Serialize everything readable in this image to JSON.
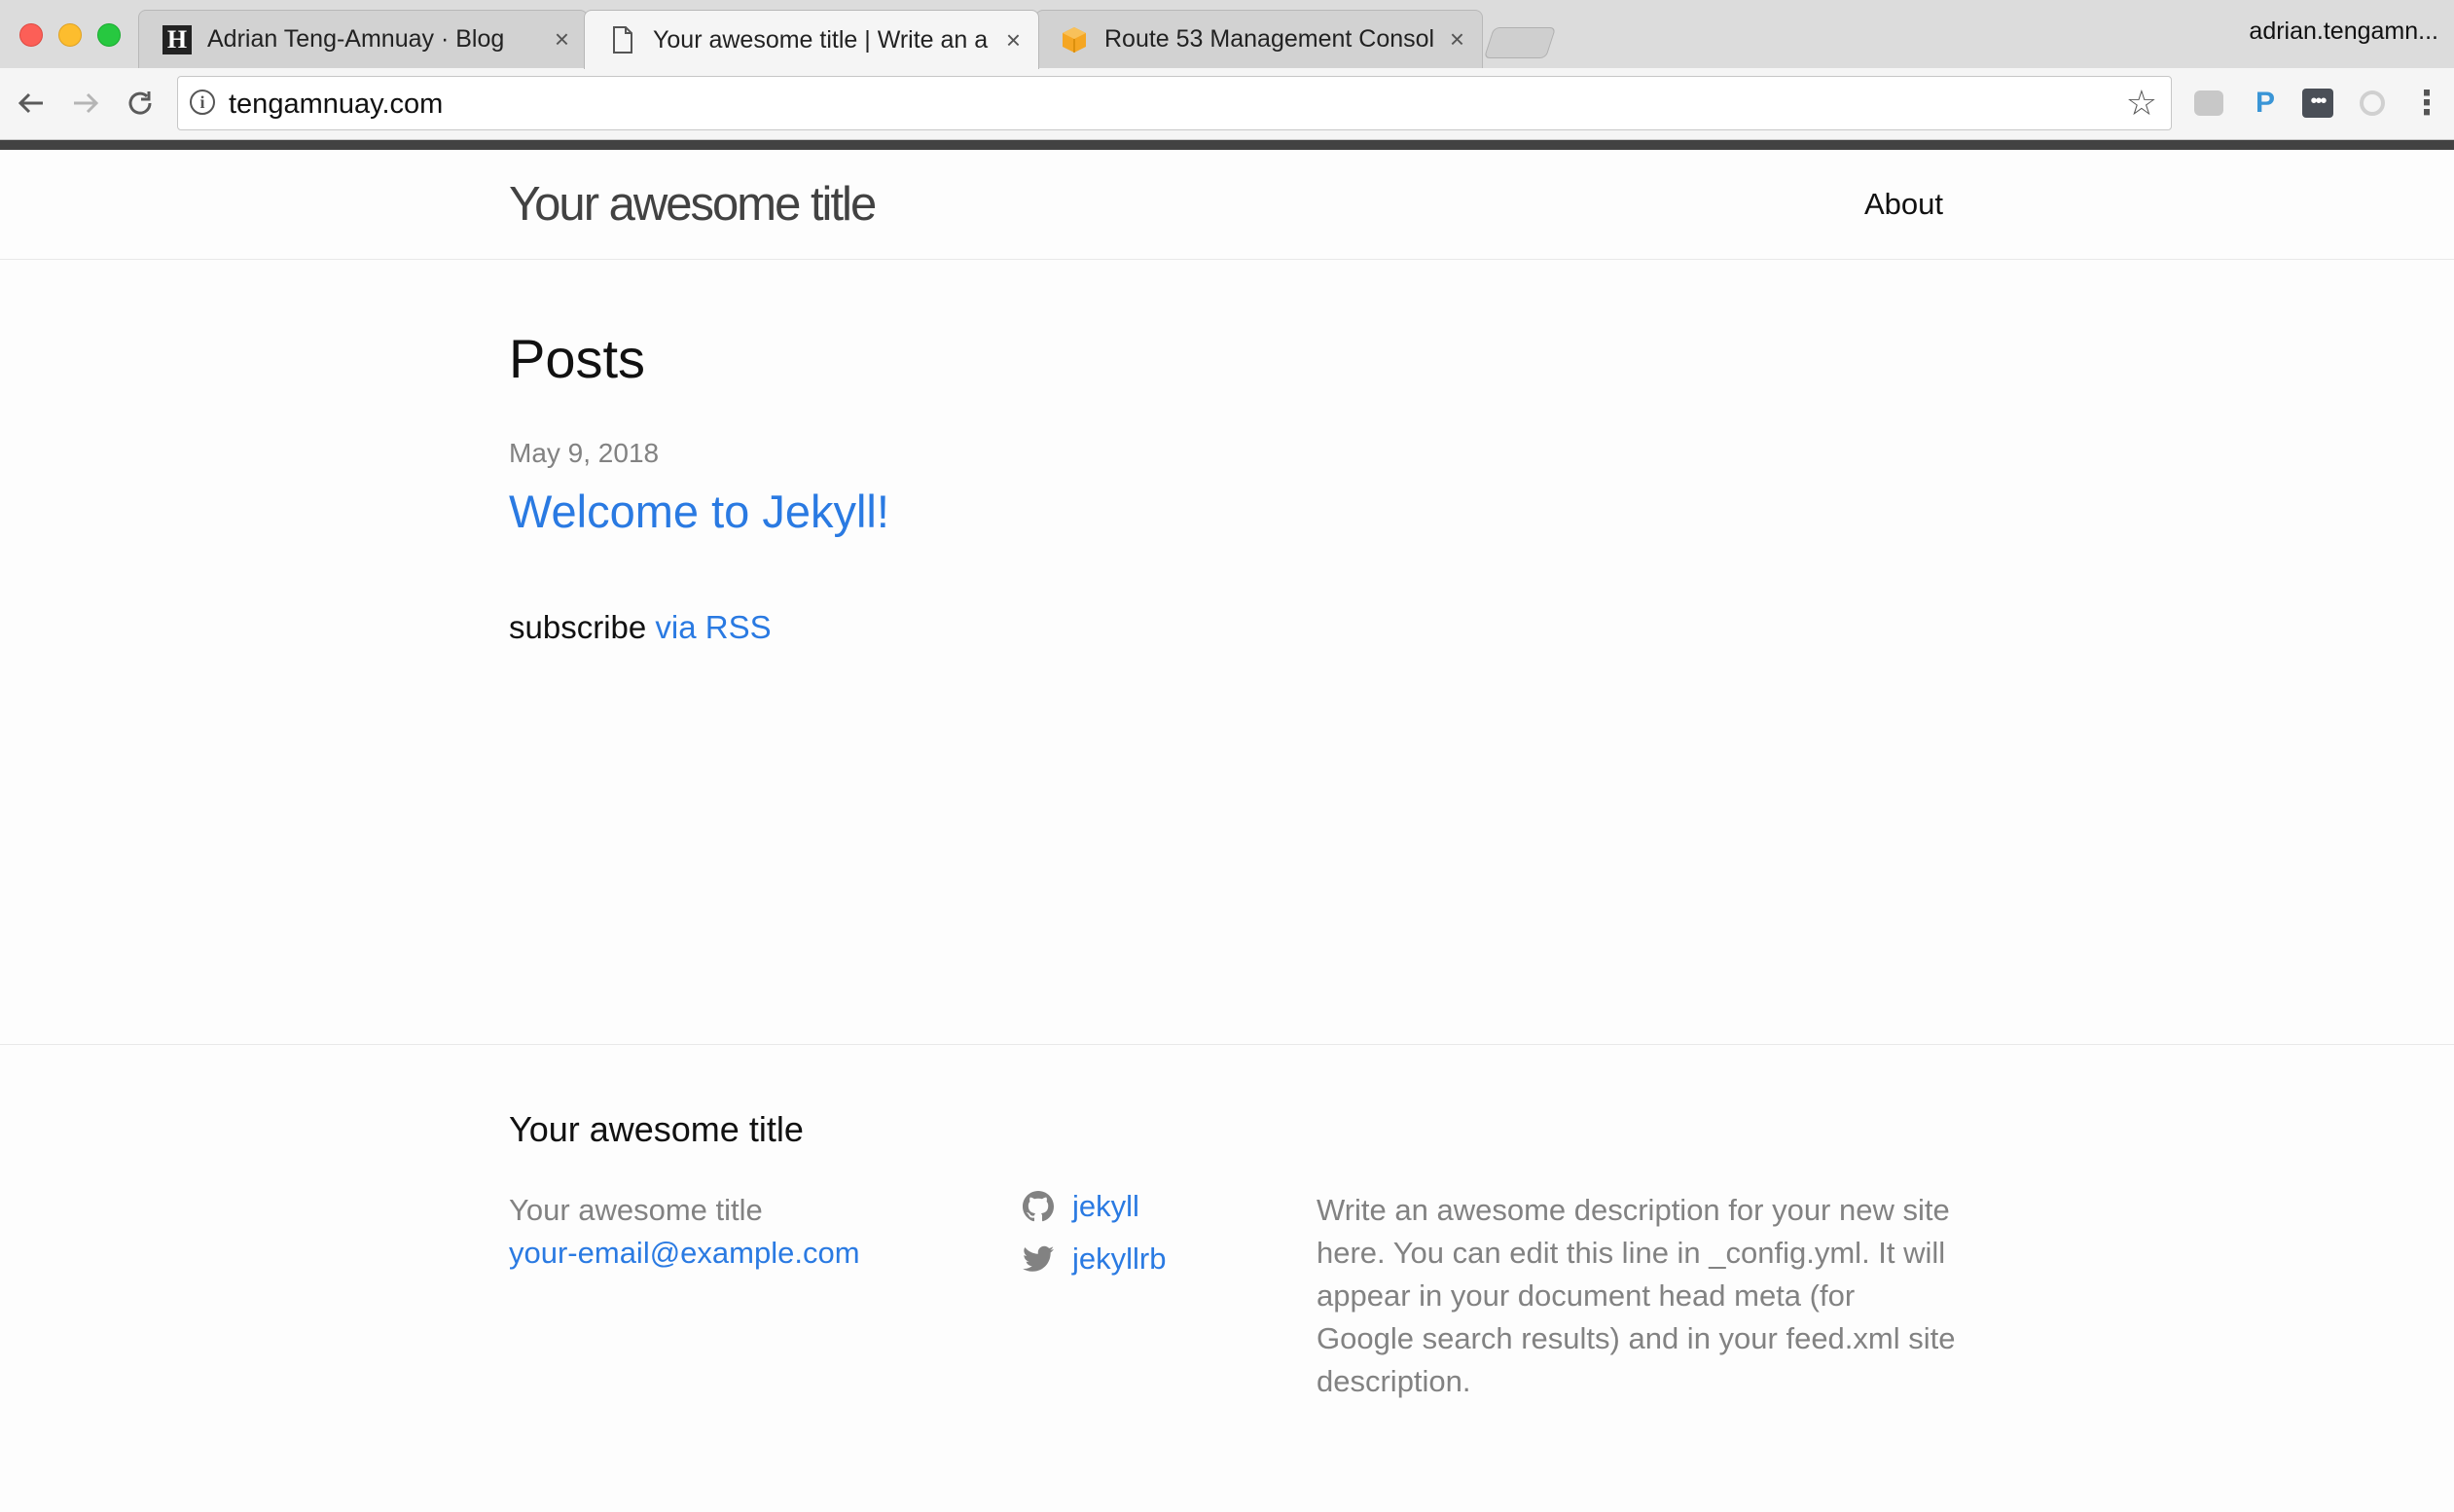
{
  "browser": {
    "tabs": [
      {
        "title": "Adrian Teng-Amnuay · Blog",
        "favicon": "h-logo-icon",
        "active": false
      },
      {
        "title": "Your awesome title | Write an a",
        "favicon": "page-icon",
        "active": true
      },
      {
        "title": "Route 53 Management Consol",
        "favicon": "aws-box-icon",
        "active": false
      }
    ],
    "profile_name": "adrian.tengamn...",
    "url": "tengamnuay.com",
    "close_glyph": "×"
  },
  "site": {
    "title": "Your awesome title",
    "nav": {
      "about": "About"
    }
  },
  "main": {
    "heading": "Posts",
    "posts": [
      {
        "date": "May 9, 2018",
        "title": "Welcome to Jekyll!"
      }
    ],
    "rss_prefix": "subscribe",
    "rss_link": "via RSS"
  },
  "footer": {
    "heading": "Your awesome title",
    "name": "Your awesome title",
    "email": "your-email@example.com",
    "github": "jekyll",
    "twitter": "jekyllrb",
    "description": "Write an awesome description for your new site here. You can edit this line in _config.yml. It will appear in your document head meta (for Google search results) and in your feed.xml site description."
  },
  "colors": {
    "link": "#2a7ae2",
    "muted": "#828282",
    "header_bar": "#424242"
  }
}
